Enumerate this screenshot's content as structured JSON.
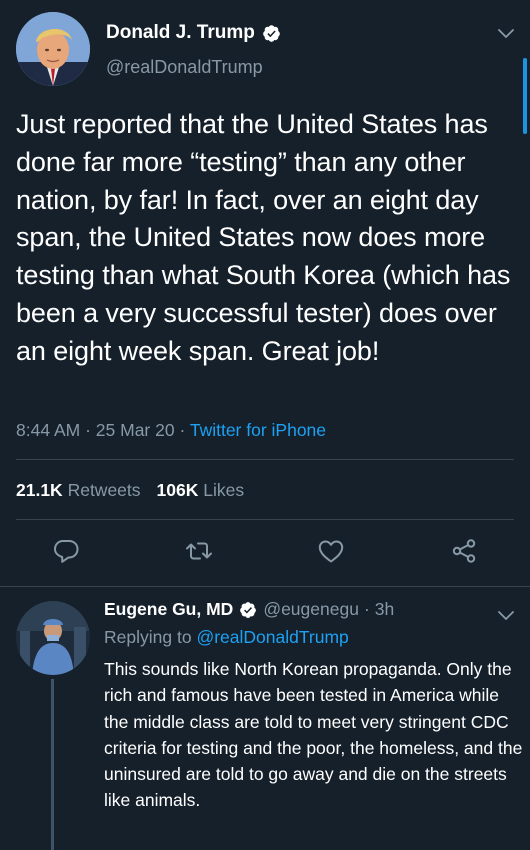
{
  "main_tweet": {
    "author_name": "Donald J. Trump",
    "handle": "@realDonaldTrump",
    "text": "Just reported that the United States has done far more “testing” than any other nation, by far! In fact, over an eight day span, the United States now does more testing than what South Korea (which has been a very successful tester) does over an eight week span. Great job!",
    "time": "8:44 AM",
    "date": "25 Mar 20",
    "separator": "·",
    "source": "Twitter for iPhone",
    "retweets_count": "21.1K",
    "retweets_label": "Retweets",
    "likes_count": "106K",
    "likes_label": "Likes"
  },
  "reply": {
    "author_name": "Eugene Gu, MD",
    "handle": "@eugenegu",
    "separator": "·",
    "age": "3h",
    "replying_label": "Replying to",
    "replying_to": "@realDonaldTrump",
    "text": "This sounds like North Korean propaganda. Only the rich and famous have been tested in America while the middle class are told to meet very stringent CDC criteria for testing and the poor, the homeless, and the uninsured are told to go away and die on the streets like animals."
  },
  "icons": [
    "verified-badge-icon",
    "chevron-down-icon",
    "reply-icon",
    "retweet-icon",
    "like-heart-icon",
    "share-icon"
  ],
  "colors": {
    "background": "#15202b",
    "accent": "#1da1f2",
    "secondary_text": "#8899a6",
    "divider": "#38444d"
  }
}
